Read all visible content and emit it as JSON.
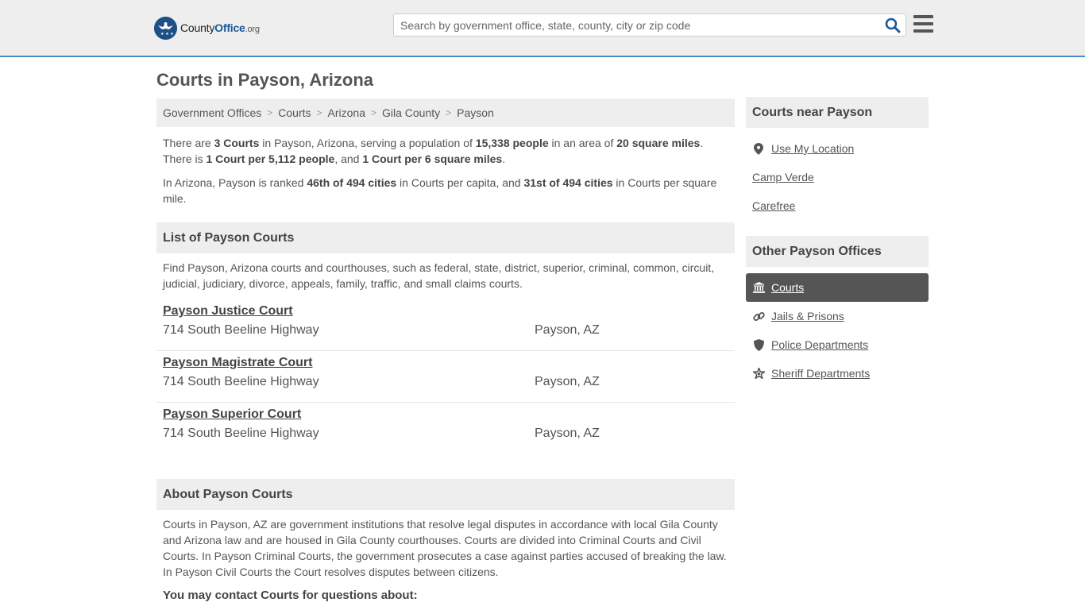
{
  "header": {
    "logo": {
      "county": "County",
      "office": "Office",
      "org": ".org"
    },
    "search_placeholder": "Search by government office, state, county, city or zip code",
    "search_icon": "search-icon",
    "menu_icon": "hamburger-menu-icon"
  },
  "page_title": "Courts in Payson, Arizona",
  "breadcrumb": [
    "Government Offices",
    "Courts",
    "Arizona",
    "Gila County",
    "Payson"
  ],
  "intro": {
    "p1": {
      "a": "There are ",
      "b1": "3 Courts",
      "c": " in Payson, Arizona, serving a population of ",
      "b2": "15,338 people",
      "d": " in an area of ",
      "b3": "20 square miles",
      "e": ". There is ",
      "b4": "1 Court per 5,112 people",
      "f": ", and ",
      "b5": "1 Court per 6 square miles",
      "g": "."
    },
    "p2": {
      "a": "In Arizona, Payson is ranked ",
      "b1": "46th of 494 cities",
      "c": " in Courts per capita, and ",
      "b2": "31st of 494 cities",
      "d": " in Courts per square mile."
    }
  },
  "list": {
    "heading": "List of Payson Courts",
    "description": "Find Payson, Arizona courts and courthouses, such as federal, state, district, superior, criminal, common, circuit, judicial, judiciary, divorce, appeals, family, traffic, and small claims courts.",
    "courts": [
      {
        "name": "Payson Justice Court",
        "address": "714 South Beeline Highway",
        "city": "Payson, AZ"
      },
      {
        "name": "Payson Magistrate Court",
        "address": "714 South Beeline Highway",
        "city": "Payson, AZ"
      },
      {
        "name": "Payson Superior Court",
        "address": "714 South Beeline Highway",
        "city": "Payson, AZ"
      }
    ]
  },
  "about": {
    "heading": "About Payson Courts",
    "text": "Courts in Payson, AZ are government institutions that resolve legal disputes in accordance with local Gila County and Arizona law and are housed in Gila County courthouses. Courts are divided into Criminal Courts and Civil Courts. In Payson Criminal Courts, the government prosecutes a case against parties accused of breaking the law. In Payson Civil Courts the Court resolves disputes between citizens.",
    "contact_question": "You may contact Courts for questions about:"
  },
  "sidebar": {
    "nearby_heading": "Courts near Payson",
    "use_location": "Use My Location",
    "nearby": [
      "Camp Verde",
      "Carefree"
    ],
    "other_heading": "Other Payson Offices",
    "offices": [
      {
        "label": "Courts",
        "icon": "courthouse-icon",
        "active": true
      },
      {
        "label": "Jails & Prisons",
        "icon": "chain-link-icon",
        "active": false
      },
      {
        "label": "Police Departments",
        "icon": "shield-icon",
        "active": false
      },
      {
        "label": "Sheriff Departments",
        "icon": "star-badge-icon",
        "active": false
      }
    ]
  },
  "colors": {
    "accent": "#4a8bc7",
    "logo_blue": "#1e4f86",
    "search_icon": "#1a5a98",
    "active_bg": "#555555",
    "panel_bg": "#eeeeef"
  }
}
